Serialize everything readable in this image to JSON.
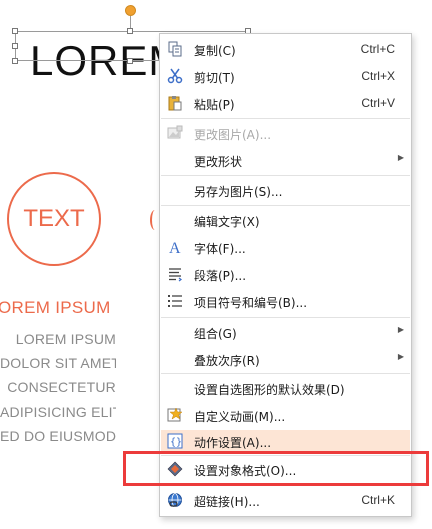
{
  "slide": {
    "title": "LOREM",
    "circle_text": "TEXT",
    "subtitle": "OREM IPSUM",
    "body_lines": [
      "LOREM IPSUM",
      "DOLOR SIT AMET",
      "CONSECTETUR",
      "ADIPISICING ELIT",
      "ED DO EIUSMOD"
    ],
    "accent_color": "#ec6a4b"
  },
  "context_menu": {
    "copy": {
      "label": "复制(C)",
      "shortcut": "Ctrl+C",
      "icon": "copy-icon"
    },
    "cut": {
      "label": "剪切(T)",
      "shortcut": "Ctrl+X",
      "icon": "scissors-icon"
    },
    "paste": {
      "label": "粘贴(P)",
      "shortcut": "Ctrl+V",
      "icon": "paste-icon"
    },
    "change_image": {
      "label": "更改图片(A)...",
      "icon": "image-icon",
      "disabled": true
    },
    "change_shape": {
      "label": "更改形状",
      "submenu": true
    },
    "save_as_image": {
      "label": "另存为图片(S)..."
    },
    "edit_text": {
      "label": "编辑文字(X)"
    },
    "font": {
      "label": "字体(F)...",
      "icon": "font-icon"
    },
    "paragraph": {
      "label": "段落(P)...",
      "icon": "paragraph-icon"
    },
    "bullets": {
      "label": "项目符号和编号(B)...",
      "icon": "bullets-icon"
    },
    "group": {
      "label": "组合(G)",
      "submenu": true
    },
    "order": {
      "label": "叠放次序(R)",
      "submenu": true
    },
    "default_effect": {
      "label": "设置自选图形的默认效果(D)"
    },
    "custom_anim": {
      "label": "自定义动画(M)...",
      "icon": "animation-icon"
    },
    "action": {
      "label": "动作设置(A)...",
      "icon": "action-icon"
    },
    "format": {
      "label": "设置对象格式(O)...",
      "icon": "format-icon"
    },
    "hyperlink": {
      "label": "超链接(H)...",
      "shortcut": "Ctrl+K",
      "icon": "hyperlink-icon"
    }
  },
  "colors": {
    "highlight": "#fde5d5",
    "annotation_box": "#ec3b3b"
  }
}
